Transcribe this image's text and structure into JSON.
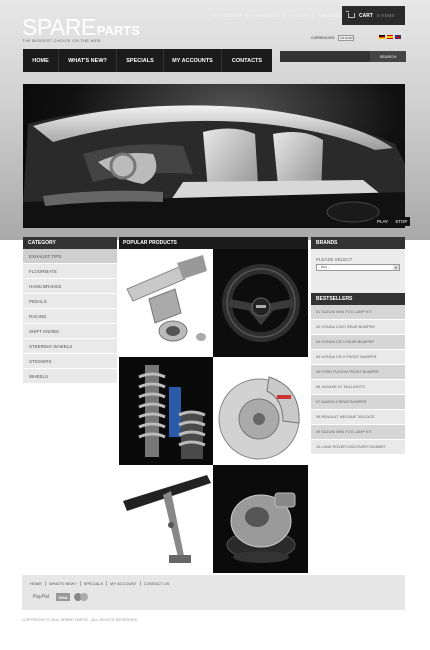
{
  "header": {
    "logo_main": "SPARE",
    "logo_sub": "PARTS",
    "tagline": "THE BIGGEST CHOICE ON THE WEB",
    "top_links": [
      "MY ACCOUNT",
      "MY WISHLIST",
      "MY CART",
      "CHECKOUT",
      "LOG IN"
    ],
    "cart_label": "CART",
    "cart_items": "0 ITEMS",
    "currencies_label": "CURRENCIES:",
    "currency_value": "US Dollar"
  },
  "nav": [
    "HOME",
    "WHAT'S NEW?",
    "SPECIALS",
    "MY ACCOUNTS",
    "CONTACTS"
  ],
  "search": {
    "button": "SEARCH",
    "placeholder": ""
  },
  "slider": {
    "play": "PLAY",
    "stop": "STOP"
  },
  "sidebar": {
    "title": "CATEGORY",
    "items": [
      "EXHAUST TIPS",
      "FLOORMATS",
      "HAND BRAKES",
      "PEDALS",
      "RACING",
      "SHIFT KNOBS",
      "STEERING WHEELS",
      "STICKERS",
      "WHEELS"
    ]
  },
  "center": {
    "title": "POPULAR PRODUCTS",
    "products": [
      "exhaust-pipe",
      "steering-wheel",
      "shock-absorber",
      "brake-disc",
      "rear-spoiler",
      "turbocharger"
    ]
  },
  "right": {
    "brands_title": "BRANDS",
    "please_select": "PLEASE SELECT",
    "select_value": "- Any -",
    "bestsellers_title": "BESTSELLERS",
    "bestsellers": [
      "01  SUZUKI MINI FOG LAMP KIT",
      "02  HONDA CIVIC REAR BUMPER",
      "03  HONDA CR-V REAR BUMPER",
      "04  HONDA CR-V FRONT BUMPER",
      "05  FORD FUSION FRONT BUMPER",
      "06  JAGUAR XJ TAILLIGHTS",
      "07  MAZDA 3 REAR BUMPER",
      "08  RENAULT MEGANE TAILGATE",
      "09  SUZUKI MINI FOG LAMP KIT",
      "10  LAND ROVER DISCOVERY BONNET"
    ]
  },
  "footer": {
    "links": [
      "HOME",
      "WHAT'S NEW?",
      "SPECIALS",
      "MY ACCOUNT",
      "CONTACT US"
    ],
    "payments": [
      "PayPal",
      "VISA",
      "MasterCard"
    ],
    "copyright": "COPYRIGHT © 2011 SPARE PARTS · ALL RIGHTS RESERVED"
  },
  "colors": {
    "dark_bar": "#1b1b1b",
    "sidebar_bg": "#e9e9e9",
    "title_bar": "#333333"
  }
}
